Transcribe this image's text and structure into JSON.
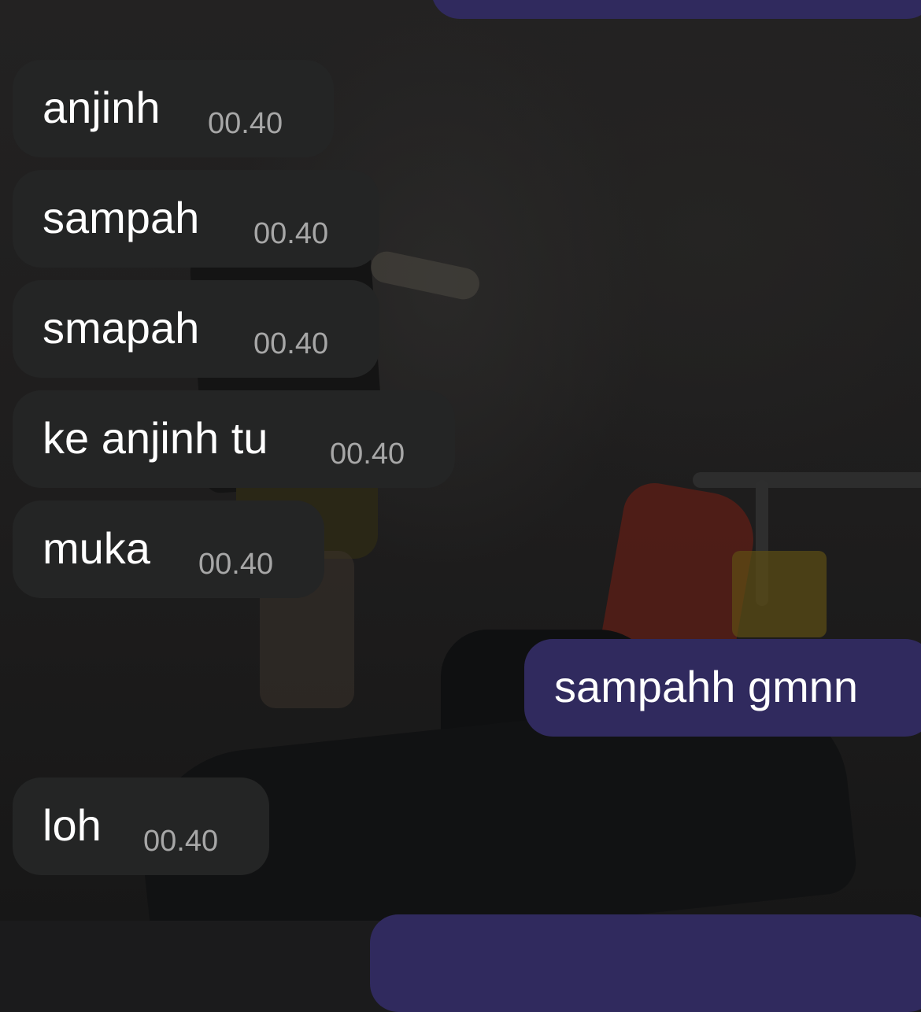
{
  "conversation": {
    "incoming": [
      {
        "text": "anjinh",
        "time": "00.40"
      },
      {
        "text": "sampah",
        "time": "00.40"
      },
      {
        "text": "smapah",
        "time": "00.40"
      },
      {
        "text": "ke anjinh tu",
        "time": "00.40"
      },
      {
        "text": "muka",
        "time": "00.40"
      },
      {
        "text": "loh",
        "time": "00.40"
      }
    ],
    "outgoing": [
      {
        "text": "sampahh gmnn"
      }
    ]
  },
  "colors": {
    "incoming_bubble": "#242525",
    "outgoing_bubble": "#302a5e",
    "time_text": "#a7a7a7"
  }
}
